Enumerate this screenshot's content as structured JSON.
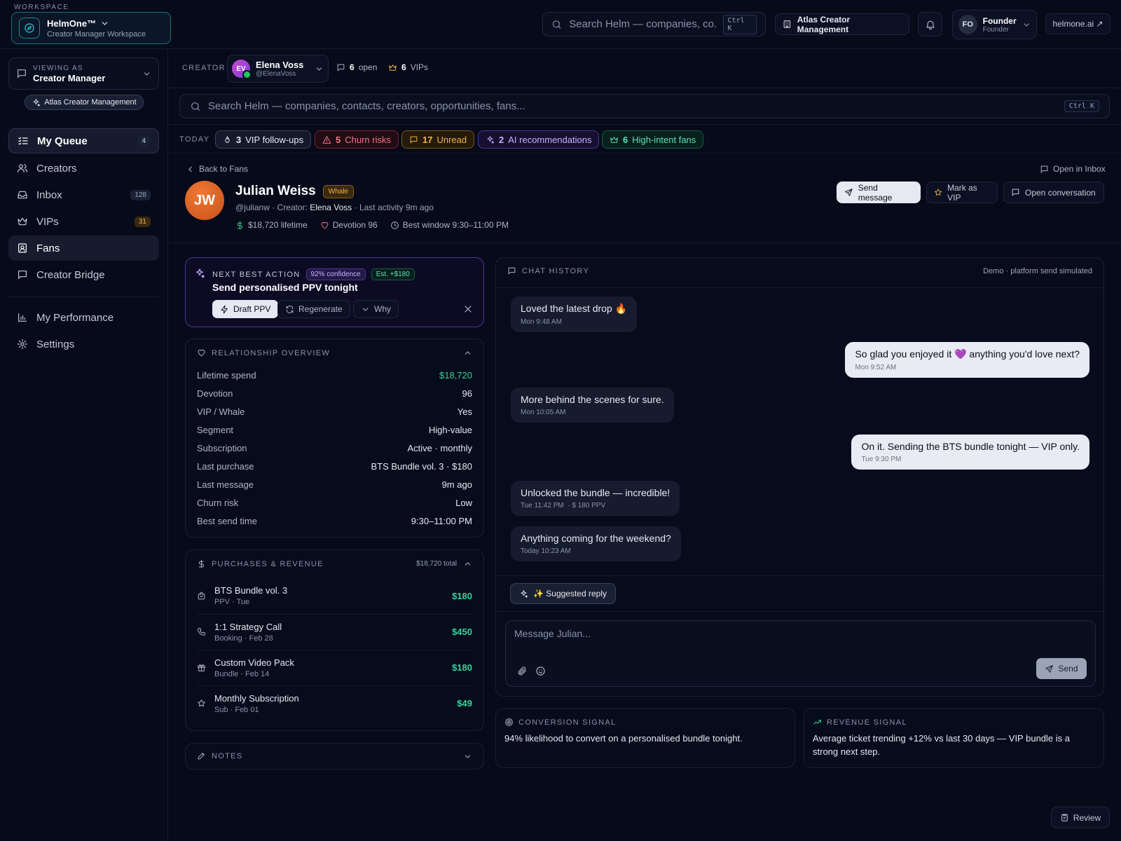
{
  "workspace": {
    "label": "WORKSPACE",
    "name": "HelmOne™",
    "subtitle": "Creator Manager Workspace"
  },
  "topbar": {
    "search_placeholder": "Search Helm — companies, co...",
    "search_kbd": "Ctrl K",
    "org": "Atlas Creator Management",
    "user": {
      "initials": "FO",
      "name": "Founder",
      "role": "Founder"
    },
    "link": "helmone.ai ↗"
  },
  "sidebar": {
    "viewing_label": "VIEWING AS",
    "viewing_role": "Creator Manager",
    "org_chip": "Atlas Creator Management",
    "items": [
      {
        "label": "My Queue",
        "count": "4"
      },
      {
        "label": "Creators",
        "count": ""
      },
      {
        "label": "Inbox",
        "count": "128"
      },
      {
        "label": "VIPs",
        "count": "31"
      },
      {
        "label": "Fans",
        "count": ""
      },
      {
        "label": "Creator Bridge",
        "count": ""
      }
    ],
    "secondary": [
      {
        "label": "My Performance"
      },
      {
        "label": "Settings"
      }
    ]
  },
  "creator_bar": {
    "label": "CREATOR",
    "initials": "EV",
    "name": "Elena Voss",
    "handle": "@ElenaVoss",
    "open_count": "6",
    "open_label": "open",
    "vip_count": "6",
    "vip_label": "VIPs"
  },
  "main_search": {
    "placeholder": "Search Helm — companies, contacts, creators, opportunities, fans...",
    "kbd": "Ctrl K"
  },
  "today": {
    "label": "TODAY",
    "chips": [
      {
        "count": "3",
        "label": "VIP follow-ups"
      },
      {
        "count": "5",
        "label": "Churn risks"
      },
      {
        "count": "17",
        "label": "Unread"
      },
      {
        "count": "2",
        "label": "AI recommendations"
      },
      {
        "count": "6",
        "label": "High-intent fans"
      }
    ]
  },
  "fan": {
    "back_label": "Back to Fans",
    "open_inbox": "Open in Inbox",
    "initials": "JW",
    "name": "Julian Weiss",
    "badge": "Whale",
    "handle": "@julianw · Creator:",
    "creator": "Elena Voss",
    "last_activity": "· Last activity 9m ago",
    "lifetime": "$18,720 lifetime",
    "devotion": "Devotion 96",
    "best_window": "Best window 9:30–11:00 PM",
    "actions": {
      "send": "Send message",
      "vip": "Mark as VIP",
      "open": "Open conversation"
    }
  },
  "nba": {
    "label": "NEXT BEST ACTION",
    "confidence": "92% confidence",
    "estimate": "Est. +$180",
    "title": "Send personalised PPV tonight",
    "btn_draft": "Draft PPV",
    "btn_regen": "Regenerate",
    "btn_why": "Why"
  },
  "relationship": {
    "title": "RELATIONSHIP OVERVIEW",
    "rows": [
      {
        "k": "Lifetime spend",
        "v": "$18,720"
      },
      {
        "k": "Devotion",
        "v": "96"
      },
      {
        "k": "VIP / Whale",
        "v": "Yes"
      },
      {
        "k": "Segment",
        "v": "High-value"
      },
      {
        "k": "Subscription",
        "v": "Active · monthly"
      },
      {
        "k": "Last purchase",
        "v": "BTS Bundle vol. 3 · $180"
      },
      {
        "k": "Last message",
        "v": "9m ago"
      },
      {
        "k": "Churn risk",
        "v": "Low"
      },
      {
        "k": "Best send time",
        "v": "9:30–11:00 PM"
      }
    ]
  },
  "purchases": {
    "title": "PURCHASES & REVENUE",
    "total": "$18,720 total",
    "items": [
      {
        "title": "BTS Bundle vol. 3",
        "sub": "PPV · Tue",
        "amount": "$180",
        "icon": "bag-icon"
      },
      {
        "title": "1:1 Strategy Call",
        "sub": "Booking · Feb 28",
        "amount": "$450",
        "icon": "phone-icon"
      },
      {
        "title": "Custom Video Pack",
        "sub": "Bundle · Feb 14",
        "amount": "$180",
        "icon": "gift-icon"
      },
      {
        "title": "Monthly Subscription",
        "sub": "Sub · Feb 01",
        "amount": "$49",
        "icon": "star-icon"
      }
    ]
  },
  "notes": {
    "title": "NOTES"
  },
  "chat": {
    "title": "CHAT HISTORY",
    "demo": "Demo · platform send simulated",
    "messages": [
      {
        "dir": "in",
        "text": "Loved the latest drop 🔥",
        "time": "Mon 9:48 AM"
      },
      {
        "dir": "out",
        "text": "So glad you enjoyed it 💜 anything you'd love next?",
        "time": "Mon 9:52 AM"
      },
      {
        "dir": "in",
        "text": "More behind the scenes for sure.",
        "time": "Mon 10:05 AM"
      },
      {
        "dir": "out",
        "text": "On it. Sending the BTS bundle tonight — VIP only.",
        "time": "Tue 9:30 PM"
      },
      {
        "dir": "in",
        "text": "Unlocked the bundle — incredible!",
        "time": "Tue 11:42 PM",
        "extra": "· $ 180 PPV"
      },
      {
        "dir": "in",
        "text": "Anything coming for the weekend?",
        "time": "Today 10:23 AM"
      }
    ],
    "suggested": "✨ Suggested reply",
    "composer_placeholder": "Message Julian...",
    "send": "Send"
  },
  "signals": {
    "conversion": {
      "title": "CONVERSION SIGNAL",
      "text": "94% likelihood to convert on a personalised bundle tonight."
    },
    "revenue": {
      "title": "REVENUE SIGNAL",
      "text": "Average ticket trending +12% vs last 30 days — VIP bundle is a strong next step."
    }
  },
  "review": "Review",
  "colors": {
    "accent": "#2fd0dc",
    "positive": "#34d399",
    "whale": "#f0b34a",
    "ai": "#8b5cf6"
  }
}
